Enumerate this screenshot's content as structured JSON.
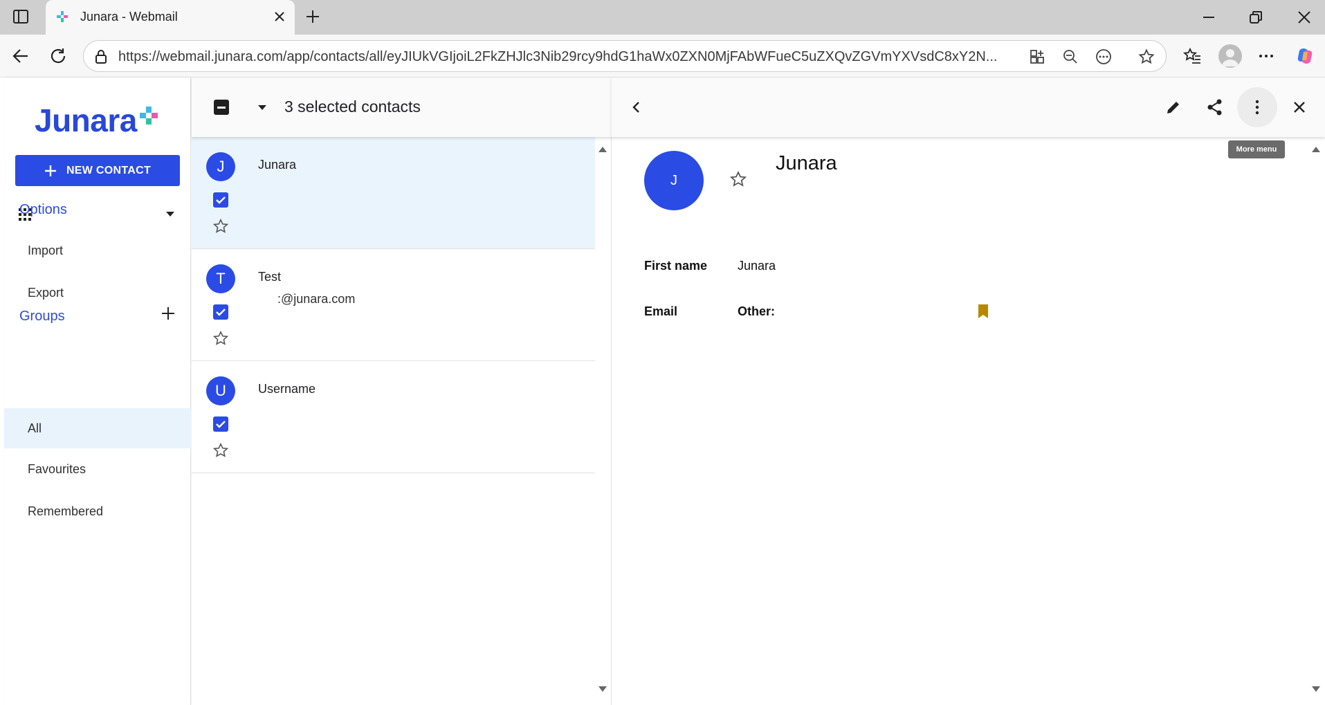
{
  "browser": {
    "tab_title": "Junara - Webmail",
    "url": "https://webmail.junara.com/app/contacts/all/eyJIUkVGIjoiL2FkZHJlc3Nib29rcy9hdG1haWx0ZXN0MjFAbWFueC5uZXQvZGVmYXVsdC8xY2N..."
  },
  "sidebar": {
    "logo_text": "Junara",
    "new_contact_label": "NEW CONTACT",
    "options_title": "Options",
    "options_items": [
      {
        "label": "Import"
      },
      {
        "label": "Export"
      }
    ],
    "groups_title": "Groups",
    "groups_items": [
      {
        "label": "All"
      },
      {
        "label": "Favourites"
      },
      {
        "label": "Remembered"
      }
    ]
  },
  "list": {
    "selected_text": "3 selected contacts",
    "contacts": [
      {
        "initial": "J",
        "name": "Junara",
        "email": ""
      },
      {
        "initial": "T",
        "name": "Test",
        "email": ":@junara.com"
      },
      {
        "initial": "U",
        "name": "Username",
        "email": ""
      }
    ]
  },
  "detail": {
    "initial": "J",
    "name": "Junara",
    "tooltip": "More menu",
    "fields": [
      {
        "label": "First name",
        "value": "Junara"
      },
      {
        "label": "Email",
        "sublabel": "Other:"
      }
    ]
  },
  "colors": {
    "accent": "#2b4be5",
    "selected_row": "#eaf4fd",
    "bookmark": "#b58a00"
  }
}
